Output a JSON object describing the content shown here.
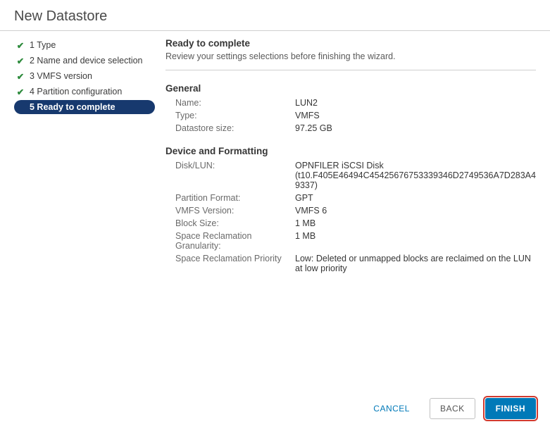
{
  "dialog_title": "New Datastore",
  "steps": {
    "items": [
      {
        "label": "1 Type"
      },
      {
        "label": "2 Name and device selection"
      },
      {
        "label": "3 VMFS version"
      },
      {
        "label": "4 Partition configuration"
      },
      {
        "label": "5 Ready to complete"
      }
    ]
  },
  "main": {
    "title": "Ready to complete",
    "subtitle": "Review your settings selections before finishing the wizard."
  },
  "general": {
    "heading": "General",
    "name_label": "Name:",
    "name_value": "LUN2",
    "type_label": "Type:",
    "type_value": "VMFS",
    "size_label": "Datastore size:",
    "size_value": "97.25 GB"
  },
  "device": {
    "heading": "Device and Formatting",
    "disklun_label": "Disk/LUN:",
    "disklun_value": "OPNFILER iSCSI Disk (t10.F405E46494C45425676753339346D2749536A7D283A49337)",
    "partfmt_label": "Partition Format:",
    "partfmt_value": "GPT",
    "vmfsver_label": "VMFS Version:",
    "vmfsver_value": "VMFS 6",
    "blocksize_label": "Block Size:",
    "blocksize_value": "1 MB",
    "gran_label": "Space Reclamation Granularity:",
    "gran_value": "1 MB",
    "prio_label": "Space Reclamation Priority",
    "prio_value": "Low: Deleted or unmapped blocks are reclaimed on the LUN at low priority"
  },
  "footer": {
    "cancel": "CANCEL",
    "back": "BACK",
    "finish": "FINISH"
  }
}
